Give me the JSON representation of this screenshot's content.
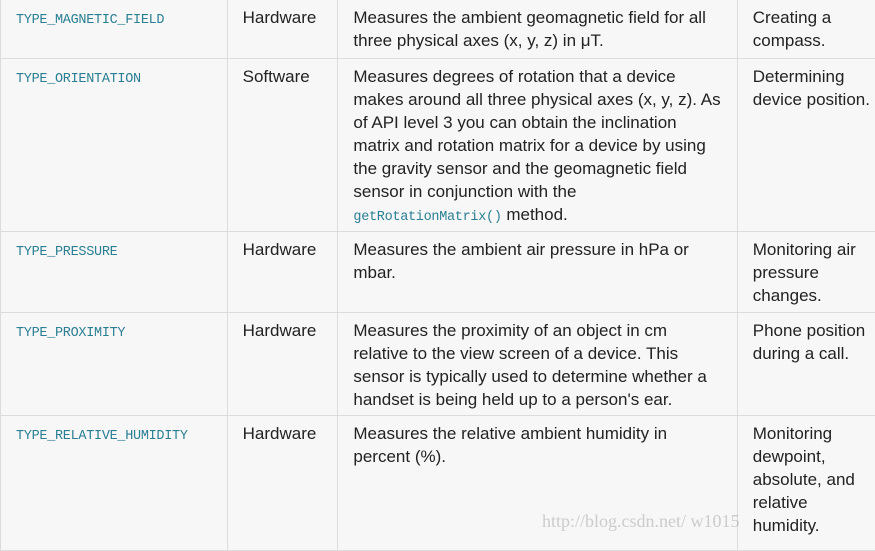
{
  "rows": [
    {
      "name": "TYPE_MAGNETIC_FIELD",
      "type": "Hardware",
      "desc": "Measures the ambient geomagnetic field for all three physical axes (x, y, z) in μT.",
      "desc_code": "",
      "desc_after": "",
      "use": "Creating a compass."
    },
    {
      "name": "TYPE_ORIENTATION",
      "type": "Software",
      "desc": "Measures degrees of rotation that a device makes around all three physical axes (x, y, z). As of API level 3 you can obtain the inclination matrix and rotation matrix for a device by using the gravity sensor and the geomagnetic field sensor in conjunction with the ",
      "desc_code": "getRotationMatrix()",
      "desc_after": " method.",
      "use": "Determining device position."
    },
    {
      "name": "TYPE_PRESSURE",
      "type": "Hardware",
      "desc": "Measures the ambient air pressure in hPa or mbar.",
      "desc_code": "",
      "desc_after": "",
      "use": "Monitoring air pressure changes."
    },
    {
      "name": "TYPE_PROXIMITY",
      "type": "Hardware",
      "desc": "Measures the proximity of an object in cm relative to the view screen of a device. This sensor is typically used to determine whether a handset is being held up to a person's ear.",
      "desc_code": "",
      "desc_after": "",
      "use": "Phone position during a call."
    },
    {
      "name": "TYPE_RELATIVE_HUMIDITY",
      "type": "Hardware",
      "desc": "Measures the relative ambient humidity in percent (%).",
      "desc_code": "",
      "desc_after": "",
      "use": "Monitoring dewpoint, absolute, and relative humidity."
    }
  ],
  "watermark": "http://blog.csdn.net/      w1015",
  "colors": {
    "code": "#2a7f93",
    "border": "#dcdcdc",
    "background": "#f7f7f7"
  }
}
